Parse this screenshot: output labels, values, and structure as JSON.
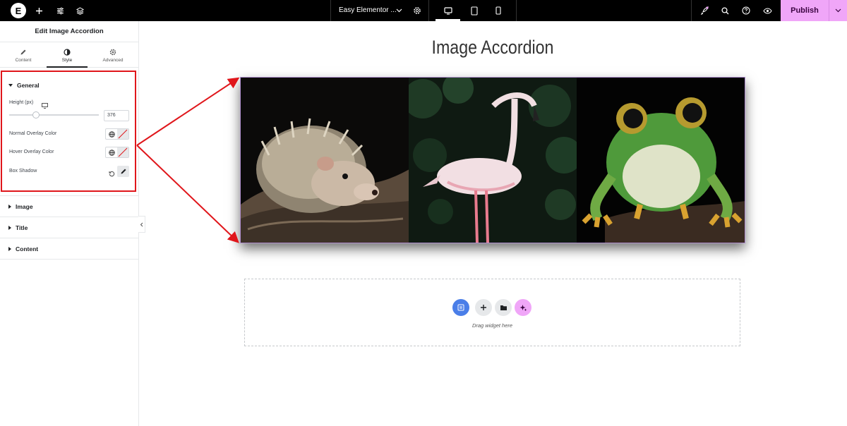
{
  "topbar": {
    "logo_letter": "E",
    "site_name": "Easy Elementor ...",
    "publish_label": "Publish"
  },
  "panel": {
    "title": "Edit Image Accordion",
    "tabs": [
      {
        "label": "Content",
        "icon": "pencil-icon"
      },
      {
        "label": "Style",
        "icon": "half-circle-icon",
        "active": true
      },
      {
        "label": "Advanced",
        "icon": "gear-icon"
      }
    ],
    "general": {
      "heading": "General",
      "height_label": "Height (px)",
      "height_value": "376",
      "normal_overlay_label": "Normal Overlay Color",
      "hover_overlay_label": "Hover Overlay Color",
      "box_shadow_label": "Box Shadow"
    },
    "sections": [
      {
        "label": "Image"
      },
      {
        "label": "Title"
      },
      {
        "label": "Content"
      }
    ]
  },
  "canvas": {
    "page_title": "Image Accordion",
    "accordion_items": [
      {
        "subject": "hedgehog"
      },
      {
        "subject": "flamingo"
      },
      {
        "subject": "frog"
      }
    ],
    "dropzone_text": "Drag widget here"
  },
  "colors": {
    "accent_publish": "#f0a6f8",
    "annotation_red": "#e0161b",
    "dropzone_blue": "#4a7ee8",
    "dropzone_ai": "#f0a6f8"
  }
}
